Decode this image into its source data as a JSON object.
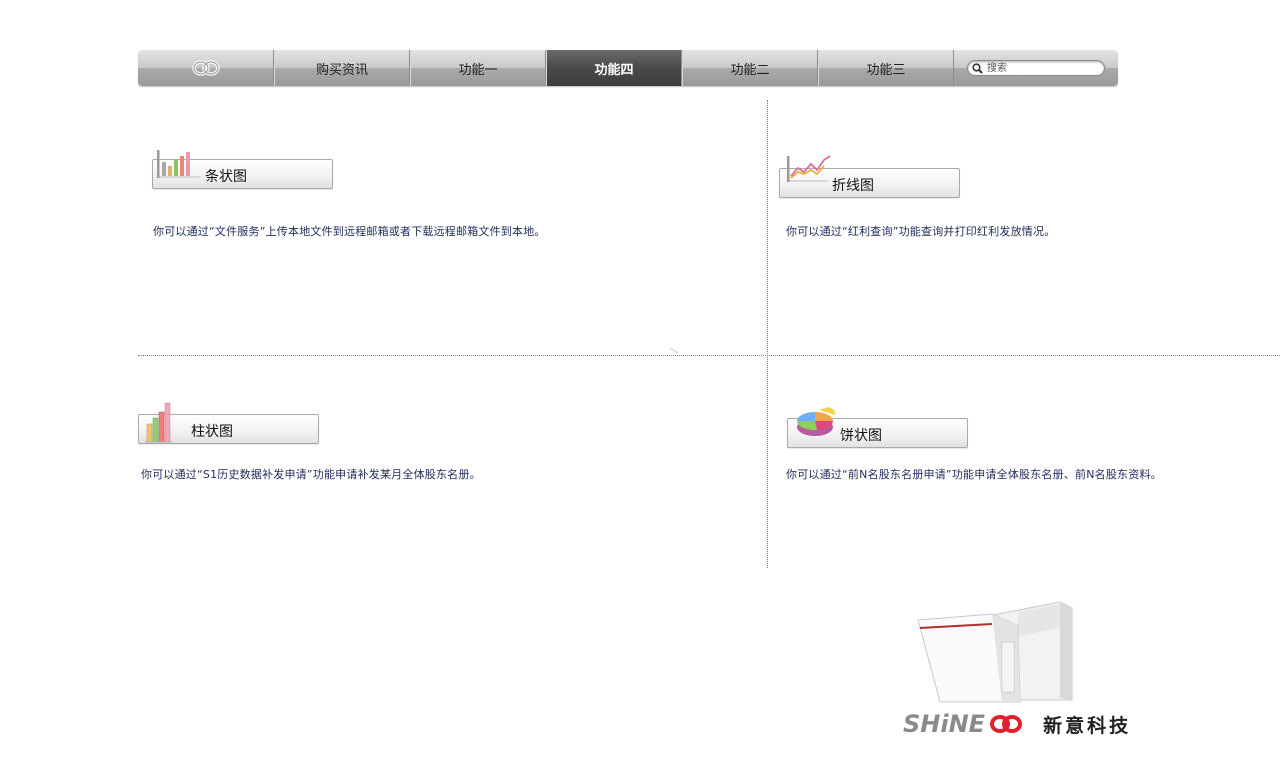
{
  "nav": {
    "items": [
      {
        "label": "购买资讯",
        "active": false
      },
      {
        "label": "功能一",
        "active": false
      },
      {
        "label": "功能四",
        "active": true
      },
      {
        "label": "功能二",
        "active": false
      },
      {
        "label": "功能三",
        "active": false
      }
    ],
    "search_placeholder": "搜索"
  },
  "cards": {
    "bar": {
      "title": "条状图",
      "desc": "你可以通过“文件服务”上传本地文件到远程邮箱或者下载远程邮箱文件到本地。"
    },
    "line": {
      "title": "折线图",
      "desc": "你可以通过“红利查询”功能查询并打印红利发放情况。"
    },
    "column": {
      "title": "柱状图",
      "desc": "你可以通过“S1历史数据补发申请”功能申请补发某月全体股东名册。"
    },
    "pie": {
      "title": "饼状图",
      "desc": "你可以通过“前N名股东名册申请”功能申请全体股东名册、前N名股东资料。"
    }
  },
  "brand": {
    "en": "SHiNE",
    "cn": "新意科技"
  }
}
